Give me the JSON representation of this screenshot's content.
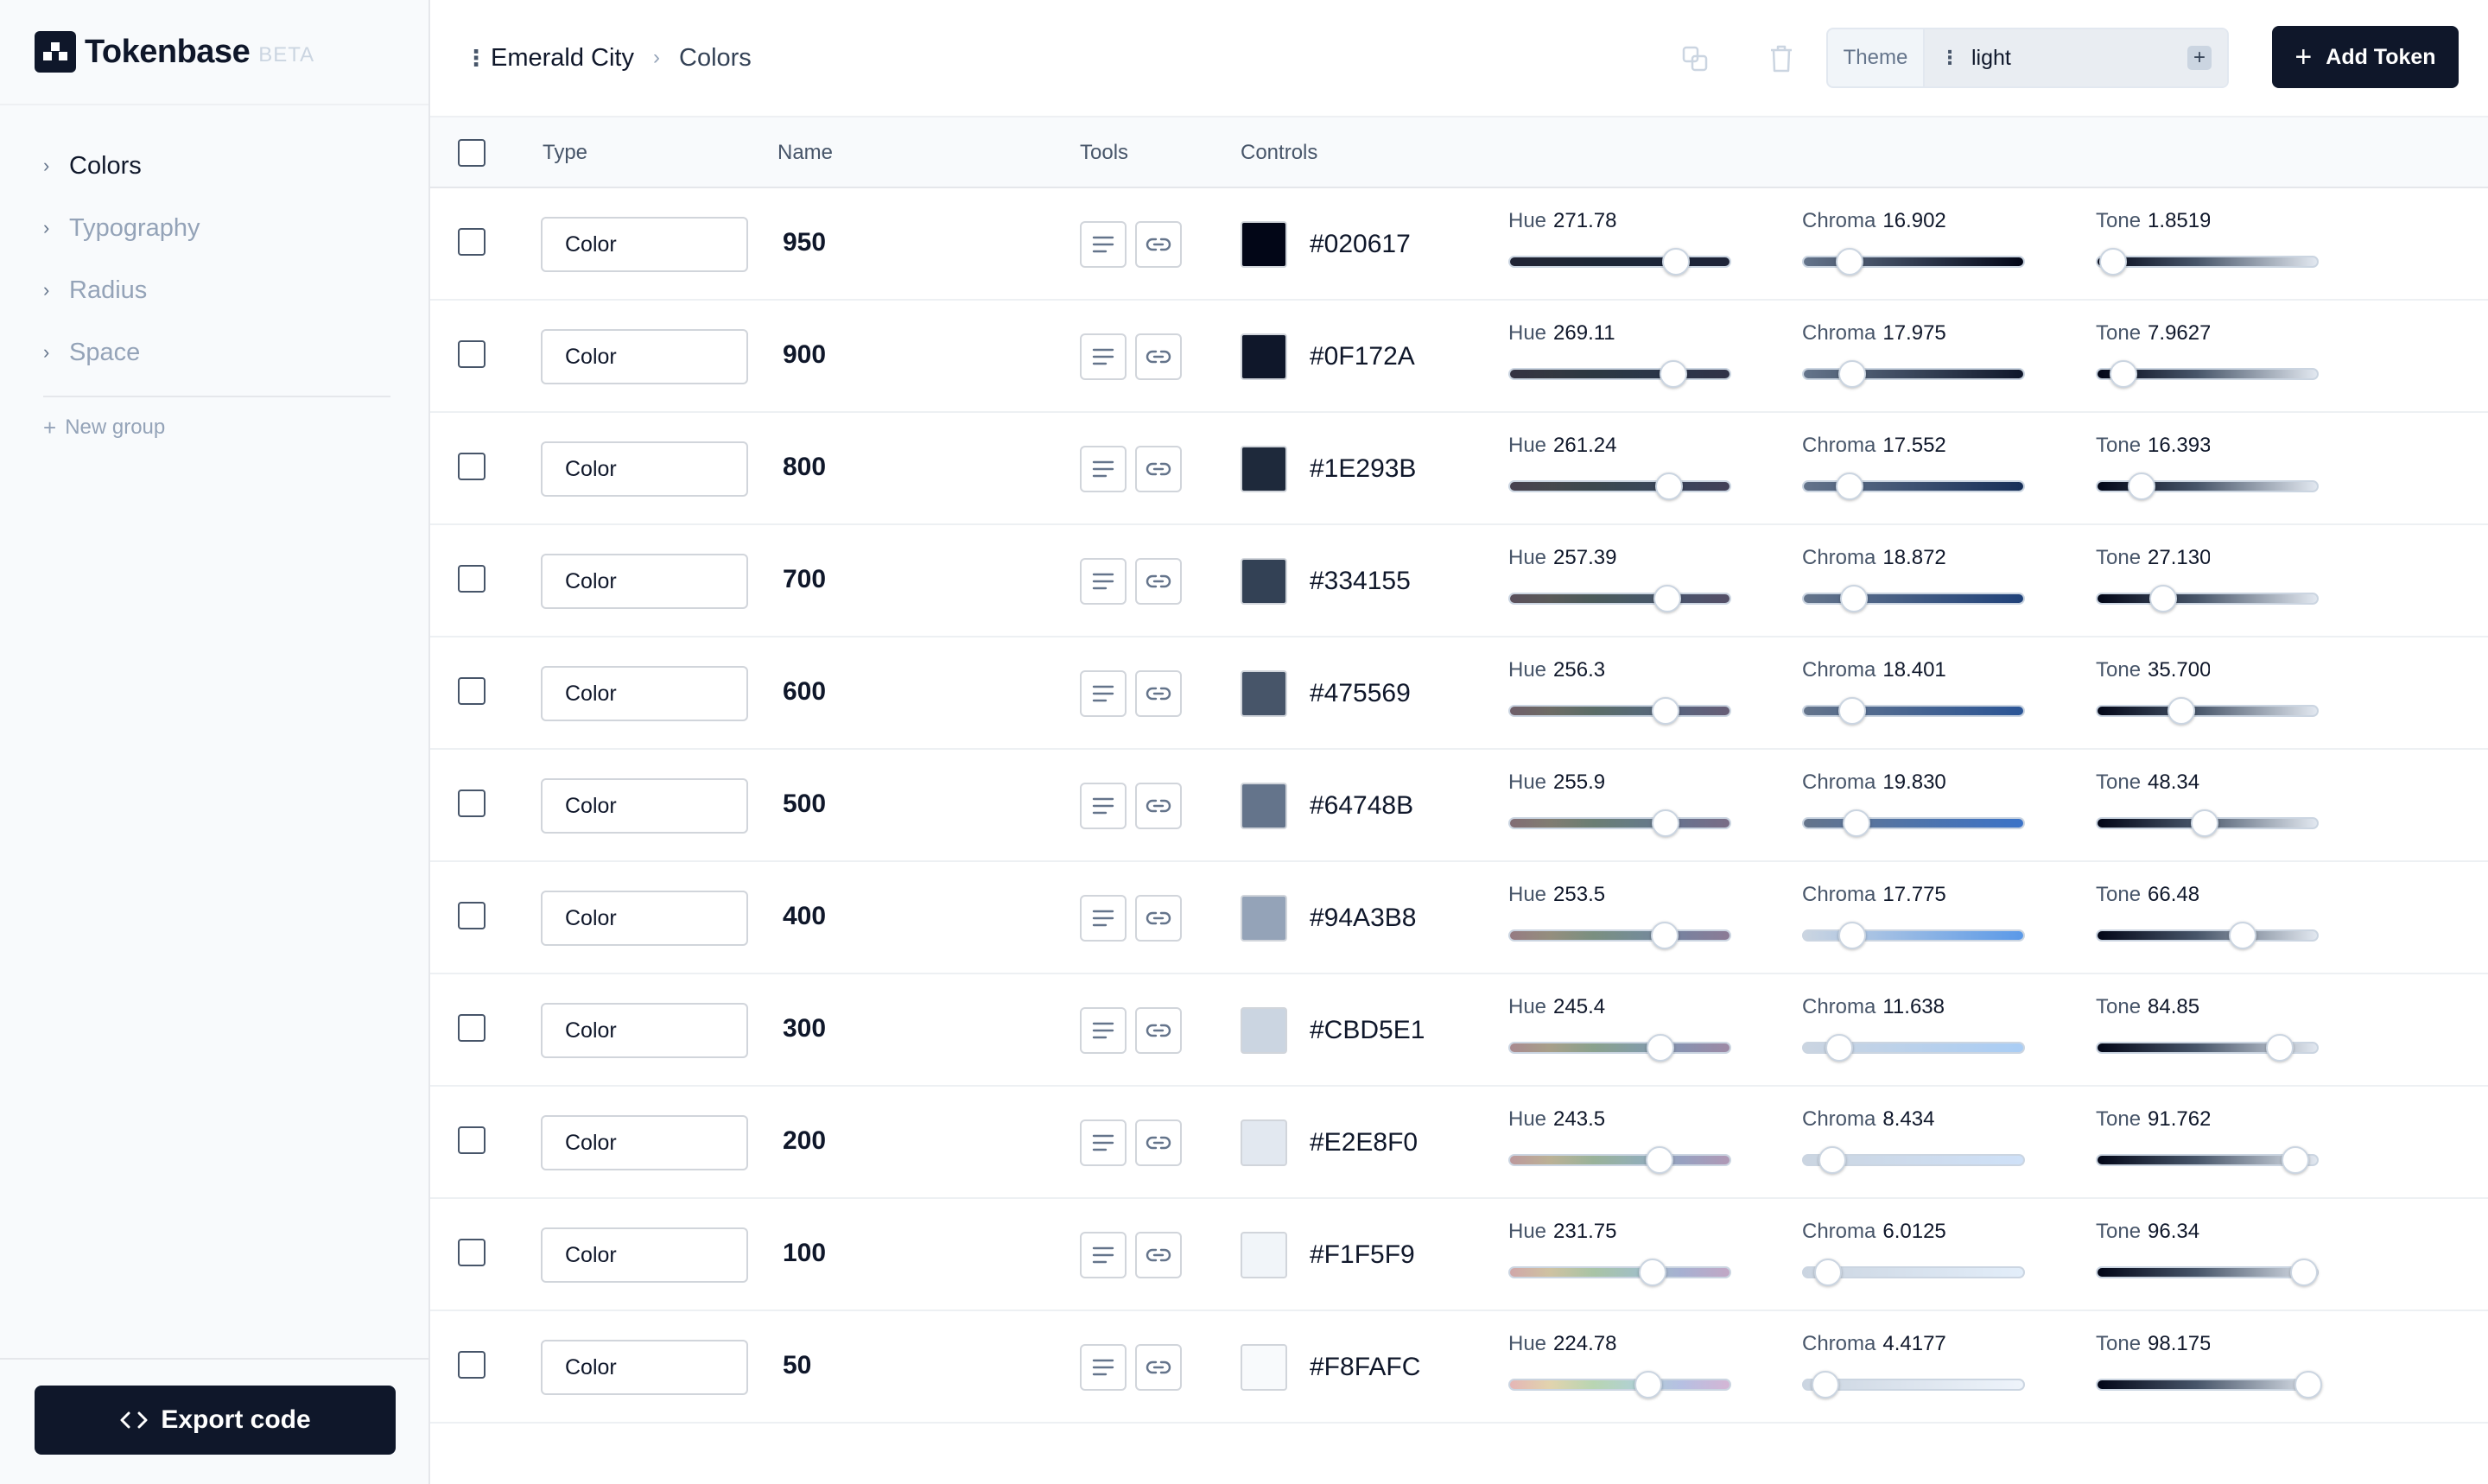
{
  "app": {
    "name": "Tokenbase",
    "tag": "BETA"
  },
  "sidebar": {
    "items": [
      {
        "label": "Colors",
        "active": true
      },
      {
        "label": "Typography",
        "active": false
      },
      {
        "label": "Radius",
        "active": false
      },
      {
        "label": "Space",
        "active": false
      }
    ],
    "new_group": "New group",
    "export": "Export code"
  },
  "header": {
    "breadcrumb": [
      "Emerald City",
      "Colors"
    ],
    "theme_label": "Theme",
    "theme_value": "light",
    "add_token": "Add Token"
  },
  "table": {
    "columns": {
      "type": "Type",
      "name": "Name",
      "tools": "Tools",
      "controls": "Controls"
    },
    "control_labels": {
      "hue": "Hue",
      "chroma": "Chroma",
      "tone": "Tone"
    },
    "rows": [
      {
        "type": "Color",
        "name": "950",
        "hex": "#020617",
        "hue": "271.78",
        "chroma": "16.902",
        "tone": "1.8519",
        "hue_pos": 0.755,
        "chroma_pos": 0.21,
        "tone_pos": 0.07,
        "chroma_color": "#020617"
      },
      {
        "type": "Color",
        "name": "900",
        "hex": "#0F172A",
        "hue": "269.11",
        "chroma": "17.975",
        "tone": "7.9627",
        "hue_pos": 0.745,
        "chroma_pos": 0.22,
        "tone_pos": 0.12,
        "chroma_color": "#0f172a"
      },
      {
        "type": "Color",
        "name": "800",
        "hex": "#1E293B",
        "hue": "261.24",
        "chroma": "17.552",
        "tone": "16.393",
        "hue_pos": 0.725,
        "chroma_pos": 0.21,
        "tone_pos": 0.2,
        "chroma_color": "#172f58"
      },
      {
        "type": "Color",
        "name": "700",
        "hex": "#334155",
        "hue": "257.39",
        "chroma": "18.872",
        "tone": "27.130",
        "hue_pos": 0.715,
        "chroma_pos": 0.23,
        "tone_pos": 0.3,
        "chroma_color": "#20427a"
      },
      {
        "type": "Color",
        "name": "600",
        "hex": "#475569",
        "hue": "256.3",
        "chroma": "18.401",
        "tone": "35.700",
        "hue_pos": 0.71,
        "chroma_pos": 0.22,
        "tone_pos": 0.38,
        "chroma_color": "#2b5596"
      },
      {
        "type": "Color",
        "name": "500",
        "hex": "#64748B",
        "hue": "255.9",
        "chroma": "19.830",
        "tone": "48.34",
        "hue_pos": 0.71,
        "chroma_pos": 0.24,
        "tone_pos": 0.49,
        "chroma_color": "#3b73c8"
      },
      {
        "type": "Color",
        "name": "400",
        "hex": "#94A3B8",
        "hue": "253.5",
        "chroma": "17.775",
        "tone": "66.48",
        "hue_pos": 0.705,
        "chroma_pos": 0.22,
        "tone_pos": 0.66,
        "chroma_color": "#5a99e8"
      },
      {
        "type": "Color",
        "name": "300",
        "hex": "#CBD5E1",
        "hue": "245.4",
        "chroma": "11.638",
        "tone": "84.85",
        "hue_pos": 0.685,
        "chroma_pos": 0.16,
        "tone_pos": 0.83,
        "chroma_color": "#a9cdf5"
      },
      {
        "type": "Color",
        "name": "200",
        "hex": "#E2E8F0",
        "hue": "243.5",
        "chroma": "8.434",
        "tone": "91.762",
        "hue_pos": 0.68,
        "chroma_pos": 0.13,
        "tone_pos": 0.9,
        "chroma_color": "#cfe1f8"
      },
      {
        "type": "Color",
        "name": "100",
        "hex": "#F1F5F9",
        "hue": "231.75",
        "chroma": "6.0125",
        "tone": "96.34",
        "hue_pos": 0.65,
        "chroma_pos": 0.11,
        "tone_pos": 0.94,
        "chroma_color": "#e3eefa"
      },
      {
        "type": "Color",
        "name": "50",
        "hex": "#F8FAFC",
        "hue": "224.78",
        "chroma": "4.4177",
        "tone": "98.175",
        "hue_pos": 0.63,
        "chroma_pos": 0.1,
        "tone_pos": 0.96,
        "chroma_color": "#eef4fb"
      }
    ]
  }
}
